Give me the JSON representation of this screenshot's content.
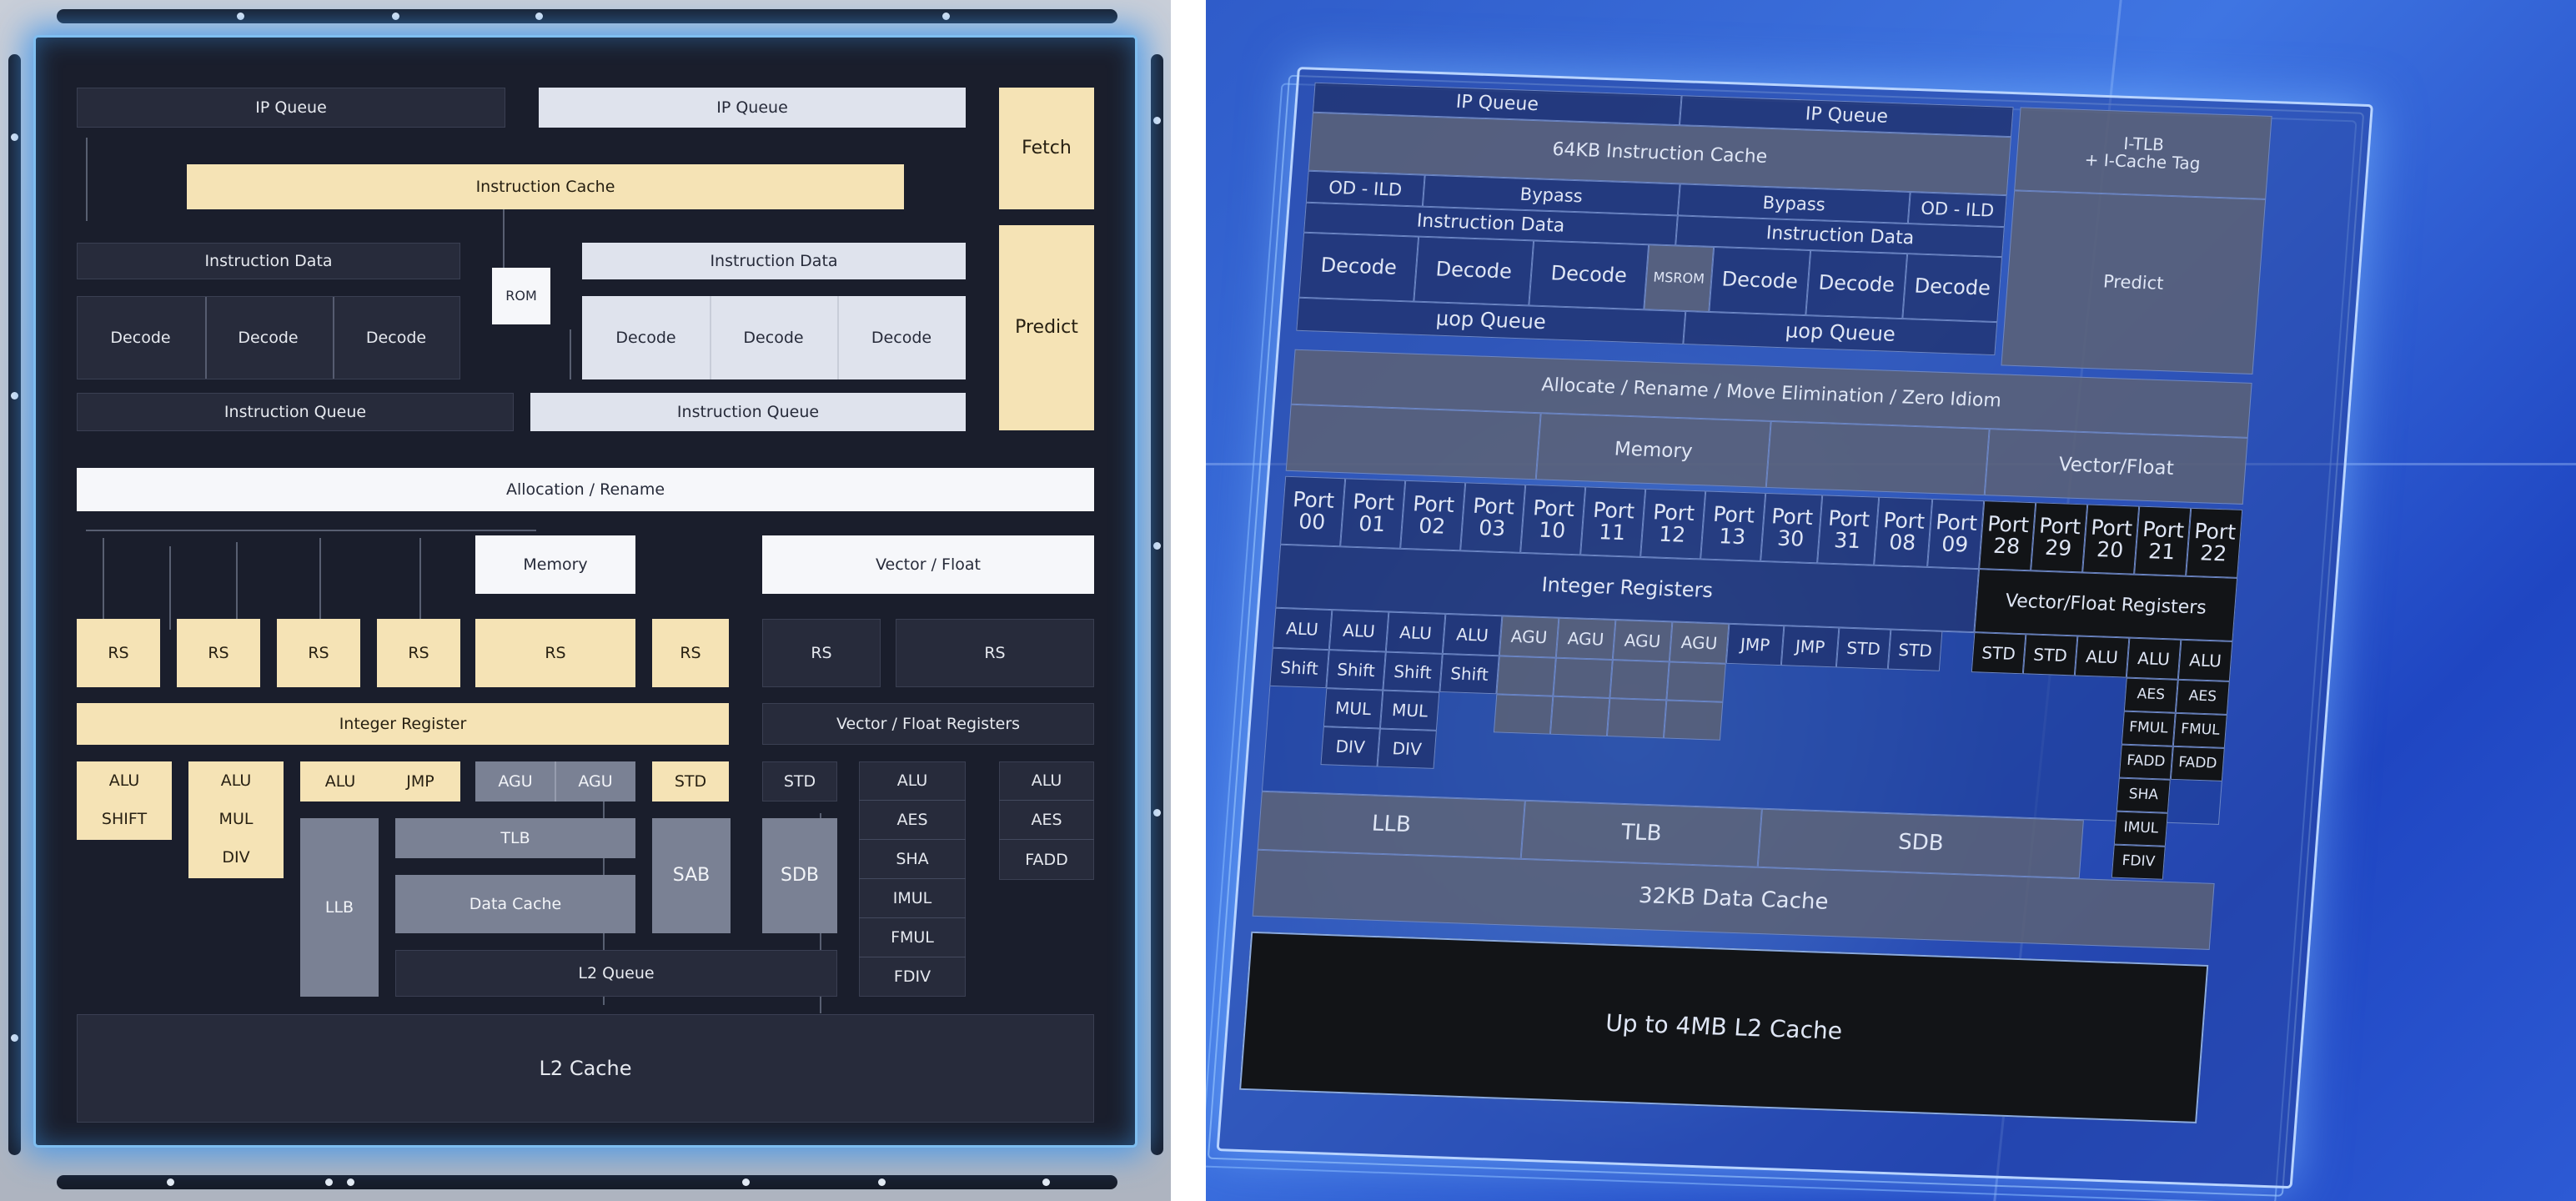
{
  "left_diagram": {
    "ip_queue_left": "IP Queue",
    "ip_queue_right": "IP Queue",
    "fetch": "Fetch",
    "instruction_cache": "Instruction Cache",
    "predict": "Predict",
    "instruction_data_left": "Instruction Data",
    "instruction_data_right": "Instruction Data",
    "rom": "ROM",
    "decode": [
      "Decode",
      "Decode",
      "Decode",
      "Decode",
      "Decode",
      "Decode"
    ],
    "instruction_queue_left": "Instruction Queue",
    "instruction_queue_right": "Instruction Queue",
    "allocation_rename": "Allocation / Rename",
    "memory": "Memory",
    "vector_float": "Vector / Float",
    "rs": [
      "RS",
      "RS",
      "RS",
      "RS",
      "RS",
      "RS",
      "RS",
      "RS"
    ],
    "integer_register": "Integer Register",
    "vector_float_registers": "Vector / Float Registers",
    "alu1": "ALU",
    "shift": "SHIFT",
    "alu2": "ALU",
    "mul": "MUL",
    "div": "DIV",
    "alu3": "ALU",
    "jmp": "JMP",
    "agu1": "AGU",
    "agu2": "AGU",
    "std1": "STD",
    "std2": "STD",
    "llb": "LLB",
    "tlb": "TLB",
    "data_cache": "Data Cache",
    "sab": "SAB",
    "sdb": "SDB",
    "l2_queue": "L2 Queue",
    "vec_col1": [
      "ALU",
      "AES",
      "SHA",
      "IMUL",
      "FMUL",
      "FDIV"
    ],
    "vec_col2": [
      "ALU",
      "AES",
      "FADD"
    ],
    "l2_cache": "L2 Cache"
  },
  "right_chip": {
    "ip_queue_1": "IP Queue",
    "ip_queue_2": "IP Queue",
    "itlb_line1": "I-TLB",
    "itlb_line2": "+ I-Cache Tag",
    "instruction_cache": "64KB Instruction Cache",
    "od_ild_1": "OD - ILD",
    "bypass_1": "Bypass",
    "bypass_2": "Bypass",
    "od_ild_2": "OD - ILD",
    "instruction_data_1": "Instruction Data",
    "instruction_data_2": "Instruction Data",
    "decode": [
      "Decode",
      "Decode",
      "Decode",
      "Decode",
      "Decode",
      "Decode"
    ],
    "msrom": "MSROM",
    "predict": "Predict",
    "uop_queue_1": "µop Queue",
    "uop_queue_2": "µop Queue",
    "allocate": "Allocate / Rename / Move Elimination / Zero Idiom",
    "memory": "Memory",
    "vector_float": "Vector/Float",
    "ports": [
      [
        "Port",
        "00"
      ],
      [
        "Port",
        "01"
      ],
      [
        "Port",
        "02"
      ],
      [
        "Port",
        "03"
      ],
      [
        "Port",
        "10"
      ],
      [
        "Port",
        "11"
      ],
      [
        "Port",
        "12"
      ],
      [
        "Port",
        "13"
      ],
      [
        "Port",
        "30"
      ],
      [
        "Port",
        "31"
      ],
      [
        "Port",
        "08"
      ],
      [
        "Port",
        "09"
      ],
      [
        "Port",
        "28"
      ],
      [
        "Port",
        "29"
      ],
      [
        "Port",
        "20"
      ],
      [
        "Port",
        "21"
      ],
      [
        "Port",
        "22"
      ]
    ],
    "integer_registers": "Integer Registers",
    "vector_float_registers": "Vector/Float Registers",
    "row1": [
      "ALU",
      "ALU",
      "ALU",
      "ALU",
      "AGU",
      "AGU",
      "AGU",
      "AGU",
      "JMP",
      "JMP",
      "STD",
      "STD",
      "STD",
      "STD",
      "ALU",
      "ALU",
      "ALU"
    ],
    "row2": [
      "Shift",
      "Shift",
      "Shift",
      "Shift"
    ],
    "row3": [
      "MUL",
      "MUL"
    ],
    "row4": [
      "DIV",
      "DIV"
    ],
    "vec_left": [
      "AES",
      "FMUL",
      "FADD",
      "SHA",
      "IMUL",
      "FDIV"
    ],
    "vec_right": [
      "AES",
      "FMUL",
      "FADD"
    ],
    "llb": "LLB",
    "tlb": "TLB",
    "sdb": "SDB",
    "data_cache": "32KB Data Cache",
    "l2_cache": "Up to 4MB L2 Cache"
  }
}
